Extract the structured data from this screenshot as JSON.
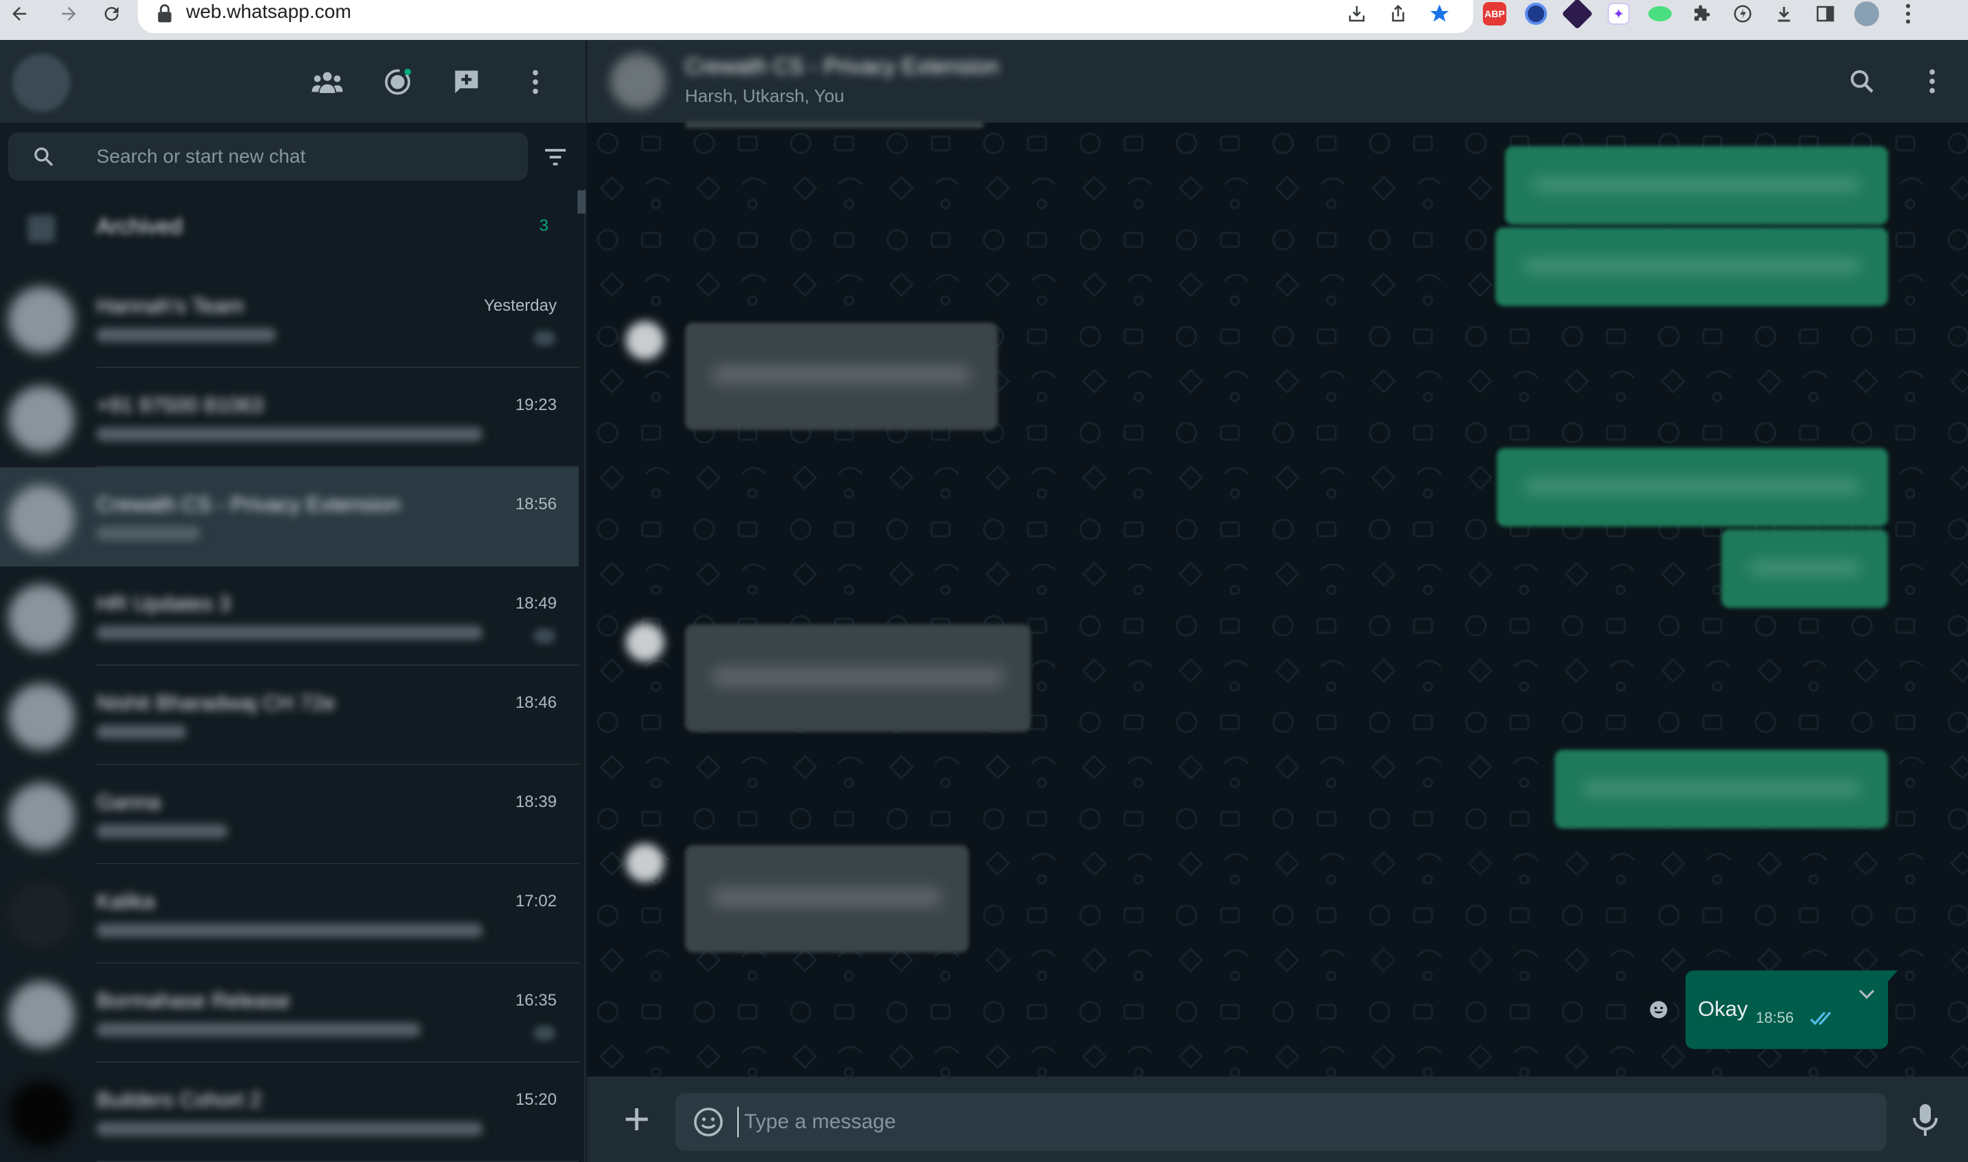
{
  "browser": {
    "url": "web.whatsapp.com"
  },
  "sidebar": {
    "search_placeholder": "Search or start new chat",
    "archived": {
      "label": "Archived",
      "count": "3"
    },
    "chats": [
      {
        "name": "Hannah's Team",
        "time": "Yesterday",
        "active": false
      },
      {
        "name": "+91 97500 81063",
        "time": "19:23",
        "active": false
      },
      {
        "name": "Crewath CS - Privacy Extension",
        "time": "18:56",
        "active": true
      },
      {
        "name": "HR Updates 3",
        "time": "18:49",
        "active": false
      },
      {
        "name": "Nishit Bharadwaj CH 72e",
        "time": "18:46",
        "active": false
      },
      {
        "name": "Ganna",
        "time": "18:39",
        "active": false
      },
      {
        "name": "Kalika",
        "time": "17:02",
        "active": false
      },
      {
        "name": "Bormahase Release",
        "time": "16:35",
        "active": false
      },
      {
        "name": "Builders Cohort 2",
        "time": "15:20",
        "active": false
      }
    ]
  },
  "conversation": {
    "group_name": "Crewath CS - Privacy Extension",
    "members": "Harsh, Utkarsh, You",
    "last_message": {
      "text": "Okay",
      "time": "18:56"
    },
    "composer_placeholder": "Type a message"
  },
  "colors": {
    "accent": "#00a884",
    "outgoing_bubble": "#005c4b",
    "panel": "#202c33",
    "background": "#111b21"
  }
}
